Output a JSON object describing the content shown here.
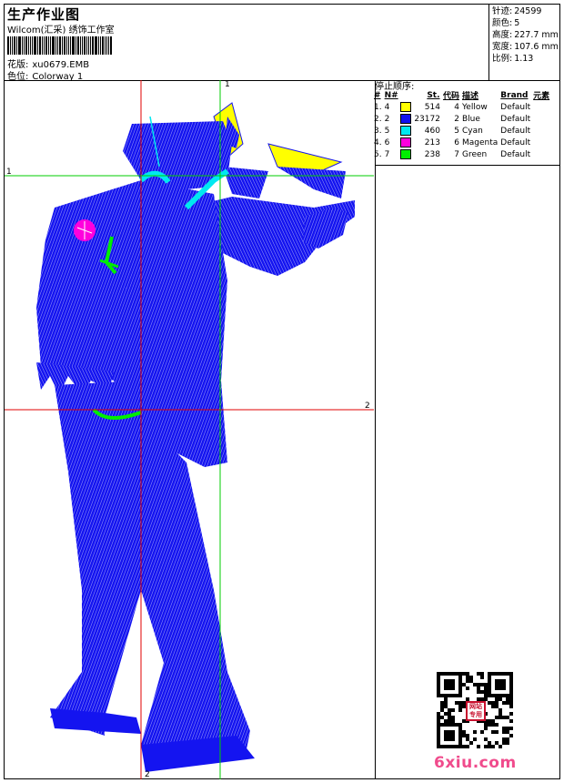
{
  "header": {
    "title": "生产作业图",
    "subtitle": "Wilcom(汇采) 绣饰工作室",
    "pattern_label": "花版:",
    "pattern_value": "xu0679.EMB",
    "colorway_label": "色位:",
    "colorway_value": "Colorway 1"
  },
  "stats": {
    "stitches_label": "针迹:",
    "stitches_value": "24599",
    "colors_label": "颜色:",
    "colors_value": "5",
    "height_label": "高度:",
    "height_value": "227.7 mm",
    "width_label": "宽度:",
    "width_value": "107.6 mm",
    "scale_label": "比例:",
    "scale_value": "1.13"
  },
  "stop_sequence": {
    "title": "停止顺序:",
    "columns": [
      "#",
      "N#",
      "St.",
      "代码",
      "描述",
      "Brand",
      "元素"
    ],
    "rows": [
      {
        "idx": "1.",
        "n": "4",
        "color": "#ffff00",
        "st": "514",
        "code": "4",
        "desc": "Yellow",
        "brand": "Default"
      },
      {
        "idx": "2.",
        "n": "2",
        "color": "#1010ee",
        "st": "23172",
        "code": "2",
        "desc": "Blue",
        "brand": "Default"
      },
      {
        "idx": "3.",
        "n": "5",
        "color": "#00e8f0",
        "st": "460",
        "code": "5",
        "desc": "Cyan",
        "brand": "Default"
      },
      {
        "idx": "4.",
        "n": "6",
        "color": "#ff00dd",
        "st": "213",
        "code": "6",
        "desc": "Magenta",
        "brand": "Default"
      },
      {
        "idx": "5.",
        "n": "7",
        "color": "#00ee00",
        "st": "238",
        "code": "7",
        "desc": "Green",
        "brand": "Default"
      }
    ]
  },
  "guides": {
    "v1_label": "1",
    "h1_label": "1",
    "h2_label": "2",
    "v2_label": "2",
    "red": "#e00000",
    "green": "#00cc00"
  },
  "stamp_text": "网站专用",
  "watermark": "6xiu.com"
}
